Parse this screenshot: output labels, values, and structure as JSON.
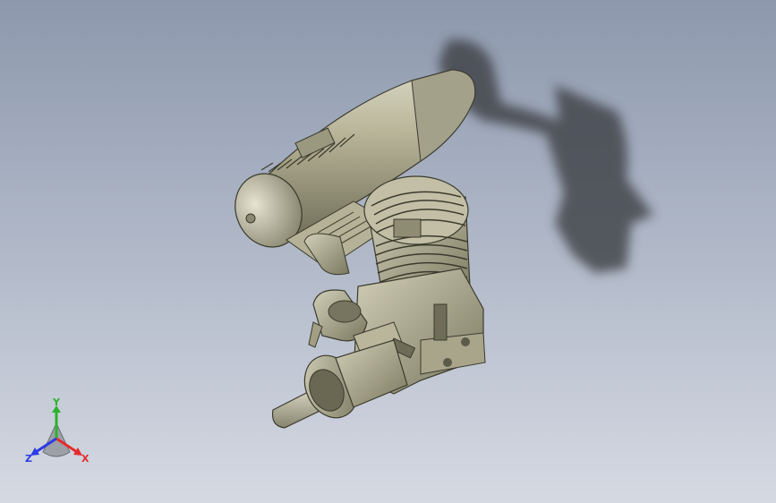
{
  "viewport": {
    "background_top": "#8d98ad",
    "background_bottom": "#d5d9e2"
  },
  "model": {
    "part_color": "#a9a688",
    "shadow_color": "#3e4044"
  },
  "triad": {
    "x_label": "X",
    "y_label": "Y",
    "z_label": "Z",
    "x_color": "#e52b2b",
    "y_color": "#2bb32b",
    "z_color": "#2b3be5"
  }
}
